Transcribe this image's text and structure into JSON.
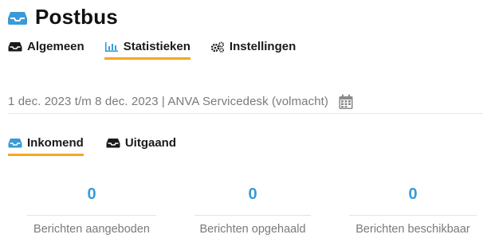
{
  "header": {
    "title": "Postbus",
    "icon": "inbox-tray-icon",
    "icon_color": "#3a9ad9"
  },
  "main_tabs": [
    {
      "label": "Algemeen",
      "icon": "inbox-icon",
      "active": false
    },
    {
      "label": "Statistieken",
      "icon": "bar-chart-icon",
      "active": true
    },
    {
      "label": "Instellingen",
      "icon": "gears-icon",
      "active": false
    }
  ],
  "filter": {
    "text": "1 dec. 2023 t/m 8 dec. 2023 | ANVA Servicedesk (volmacht)",
    "icon": "calendar-icon"
  },
  "sub_tabs": [
    {
      "label": "Inkomend",
      "icon": "inbox-icon",
      "active": true
    },
    {
      "label": "Uitgaand",
      "icon": "inbox-icon",
      "active": false
    }
  ],
  "stats": [
    {
      "value": "0",
      "label": "Berichten aangeboden"
    },
    {
      "value": "0",
      "label": "Berichten opgehaald"
    },
    {
      "value": "0",
      "label": "Berichten beschikbaar"
    }
  ],
  "colors": {
    "accent": "#f5a623",
    "value_blue": "#3a9ad9",
    "muted_text": "#7a7a7a"
  }
}
